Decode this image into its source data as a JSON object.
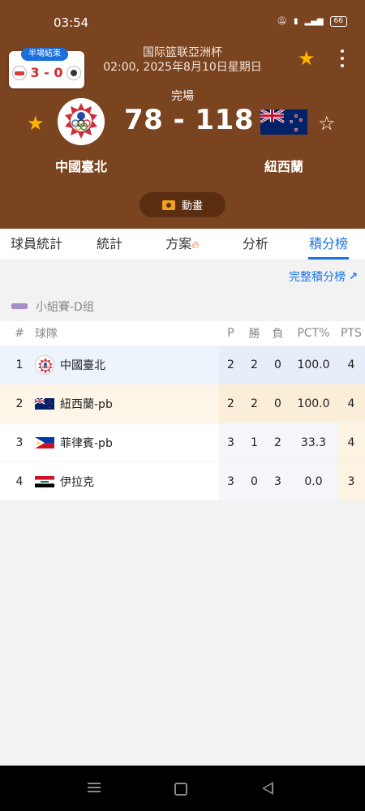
{
  "status_bar": {
    "time": "03:54",
    "icons": [
      "mute-icon",
      "volte-icon",
      "wifi-icon",
      "signal-icon"
    ],
    "battery": "66"
  },
  "header": {
    "league": "国际篮联亞洲杯",
    "datetime": "02:00, 2025年8月10日星期日",
    "match_status": "完場",
    "score": "78 - 118",
    "home_team": "中國臺北",
    "away_team": "紐西蘭",
    "home_favorited": true,
    "away_favorited": false,
    "animation_label": "動畫",
    "colors": {
      "background": "#7b4420",
      "star_active": "#ffb400"
    }
  },
  "mini_card": {
    "badge": "半場結束",
    "score": "3 - 0"
  },
  "tabs": [
    {
      "label": "球員統計",
      "active": false
    },
    {
      "label": "統計",
      "active": false
    },
    {
      "label": "方案",
      "active": false,
      "icon": "flame-icon"
    },
    {
      "label": "分析",
      "active": false
    },
    {
      "label": "積分榜",
      "active": true
    }
  ],
  "standings": {
    "full_link": "完整積分榜",
    "group": "小組賽-D组",
    "headers": {
      "rank": "#",
      "team": "球隊",
      "p": "P",
      "w": "勝",
      "l": "負",
      "pct": "PCT%",
      "pts": "PTS"
    },
    "rows": [
      {
        "rank": "1",
        "team": "中國臺北",
        "p": "2",
        "w": "2",
        "l": "0",
        "pct": "100.0",
        "pts": "4",
        "flag": "chinese-taipei-logo"
      },
      {
        "rank": "2",
        "team": "紐西蘭-pb",
        "p": "2",
        "w": "2",
        "l": "0",
        "pct": "100.0",
        "pts": "4",
        "flag": "new-zealand-flag"
      },
      {
        "rank": "3",
        "team": "菲律賓-pb",
        "p": "3",
        "w": "1",
        "l": "2",
        "pct": "33.3",
        "pts": "4",
        "flag": "philippines-flag"
      },
      {
        "rank": "4",
        "team": "伊拉克",
        "p": "3",
        "w": "0",
        "l": "3",
        "pct": "0.0",
        "pts": "3",
        "flag": "iraq-flag"
      }
    ]
  }
}
